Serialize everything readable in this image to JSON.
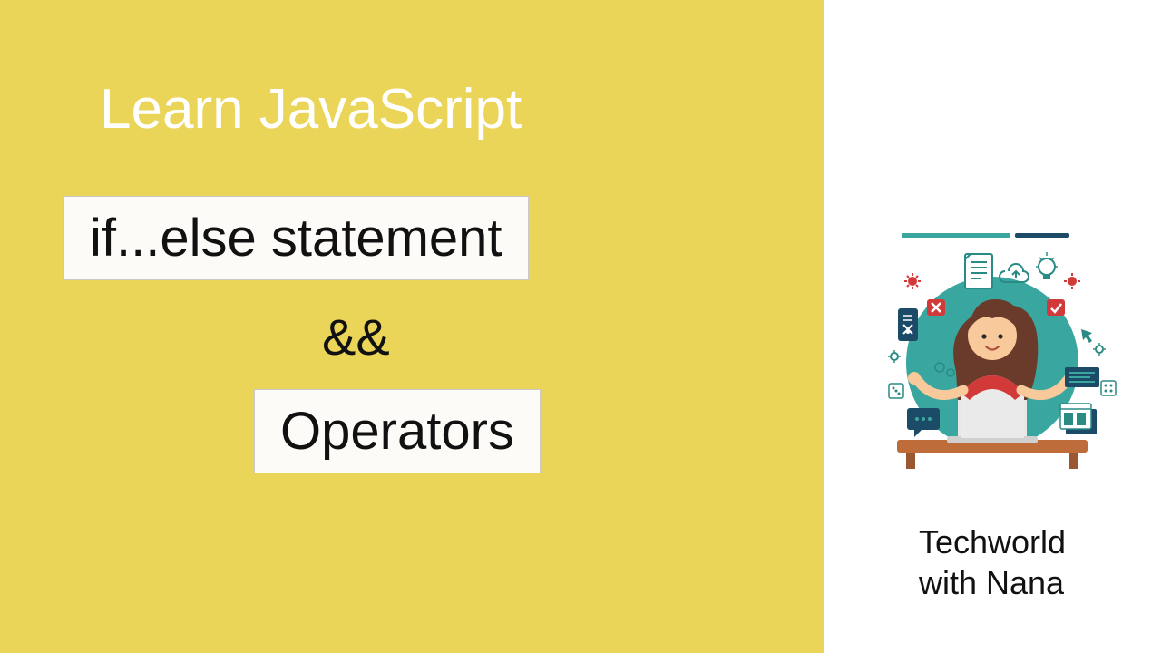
{
  "left": {
    "heading": "Learn JavaScript",
    "pill1": "if...else statement",
    "amp": "&&",
    "pill2": "Operators"
  },
  "right": {
    "brand_line1": "Techworld",
    "brand_line2": "with Nana"
  }
}
